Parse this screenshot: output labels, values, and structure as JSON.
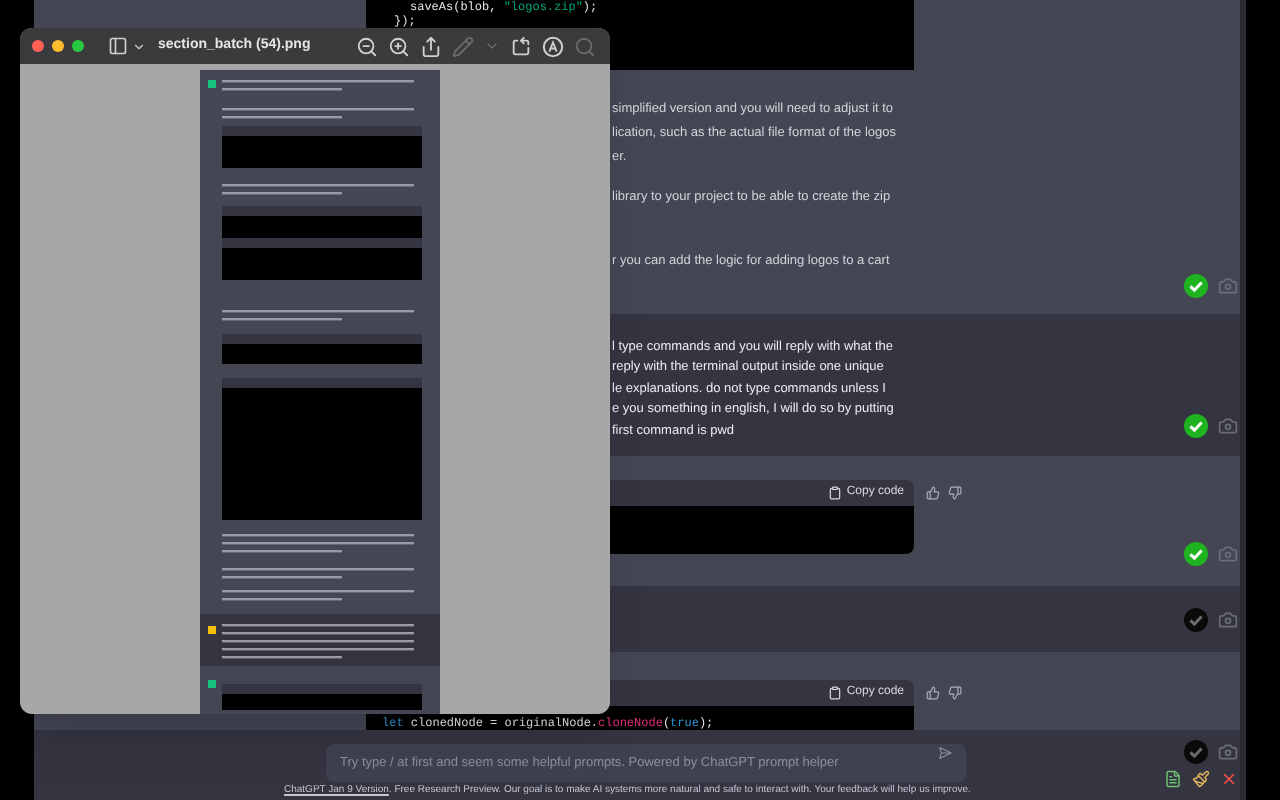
{
  "preview_window": {
    "title": "section_batch (54).png",
    "toolbar": [
      {
        "kind": "zoom-out",
        "disabled": false
      },
      {
        "kind": "zoom-in",
        "disabled": false
      },
      {
        "kind": "share",
        "disabled": false
      },
      {
        "kind": "pencil",
        "disabled": true
      },
      {
        "kind": "chevron",
        "disabled": true
      },
      {
        "kind": "rotate",
        "disabled": false
      },
      {
        "kind": "markup",
        "disabled": false
      },
      {
        "kind": "search",
        "disabled": true
      }
    ]
  },
  "messages": [
    {
      "kind": "assistant",
      "marked": true,
      "code": [
        [
          {
            "text": "saveAs(blob, ",
            "kind": "plain"
          },
          {
            "text": "\"logos.zip\"",
            "kind": "string"
          },
          {
            "text": ");",
            "kind": "plain"
          }
        ],
        [
          {
            "text": "});",
            "kind": "plain"
          }
        ]
      ],
      "paragraphs": [
        "simplified version and you will need to adjust it to",
        "lication, such as the actual file format of the logos",
        "er.",
        "library to your project to be able to create the zip",
        "r you can add the logic for adding logos to a cart"
      ]
    },
    {
      "kind": "user",
      "marked": true,
      "paragraphs": [
        "l type commands and you will reply with what the",
        "reply with the terminal output inside one unique",
        "le explanations. do not type commands unless I",
        "e you something in english, I will do so by putting",
        "first command is pwd"
      ]
    },
    {
      "kind": "assistant",
      "marked": true,
      "copy_label": "Copy code"
    },
    {
      "kind": "user",
      "marked": false
    },
    {
      "kind": "assistant",
      "marked": false,
      "copy_label": "Copy code",
      "code": [
        [
          {
            "text": "let",
            "kind": "keyword"
          },
          {
            "text": " clonedNode = originalNode.",
            "kind": "plain"
          },
          {
            "text": "cloneNode",
            "kind": "function"
          },
          {
            "text": "(",
            "kind": "plain"
          },
          {
            "text": "true",
            "kind": "keyword"
          },
          {
            "text": ");",
            "kind": "plain"
          }
        ]
      ]
    }
  ],
  "prompt_input": {
    "placeholder": "Try type / at first and seem some helpful prompts. Powered by ChatGPT prompt helper"
  },
  "footer": {
    "link": "ChatGPT Jan 9 Version",
    "text": ". Free Research Preview. Our goal is to make AI systems more natural and safe to interact with. Your feedback will help us improve."
  }
}
